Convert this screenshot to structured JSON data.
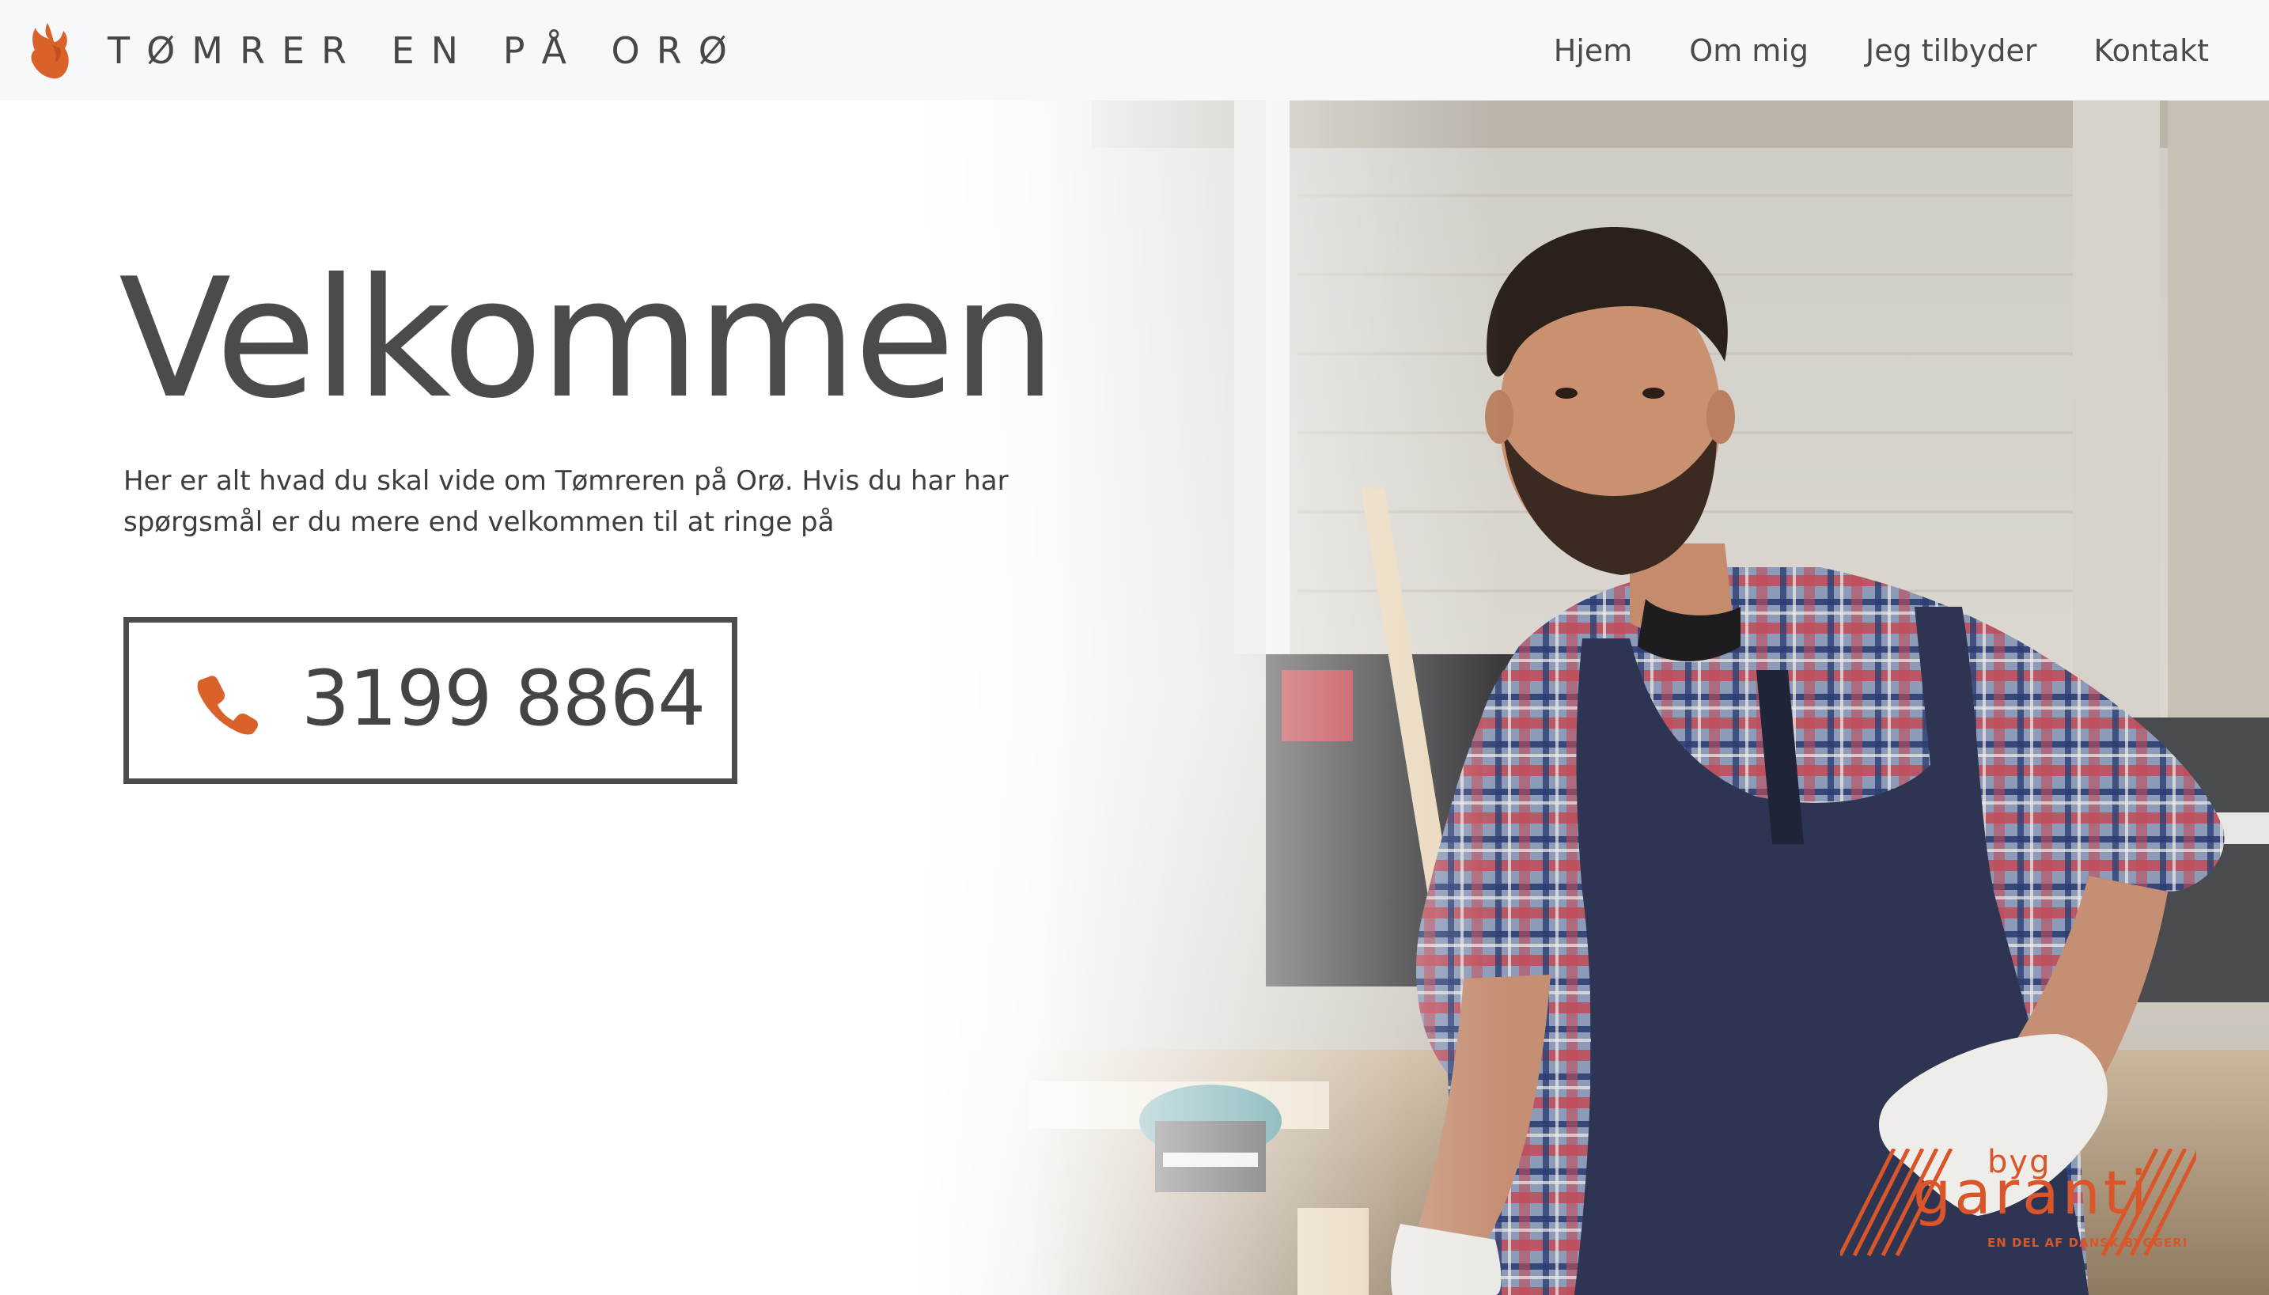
{
  "navbar": {
    "brand_name": "TØMRER EN PÅ ORØ",
    "brand_logo": "fox-logo-icon",
    "links": [
      {
        "label": "Hjem"
      },
      {
        "label": "Om mig"
      },
      {
        "label": "Jeg tilbyder"
      },
      {
        "label": "Kontakt"
      }
    ]
  },
  "hero": {
    "headline": "Velkommen",
    "lead": "Her er alt hvad du skal vide om Tømreren på Orø. Hvis du har har spørgsmål er du mere end velkommen til at ringe på",
    "phone_icon": "phone-icon",
    "phone_number": "3199 8864",
    "photo": "carpenter-in-workshop-photo"
  },
  "badge": {
    "top": "byg",
    "main": "garanti",
    "sub": "EN DEL AF DANSK BYGGERI"
  },
  "colors": {
    "accent": "#d9612a",
    "text_dark": "#4b4b4b",
    "navbar_bg": "#f7f8f9",
    "badge": "#d9562b"
  }
}
